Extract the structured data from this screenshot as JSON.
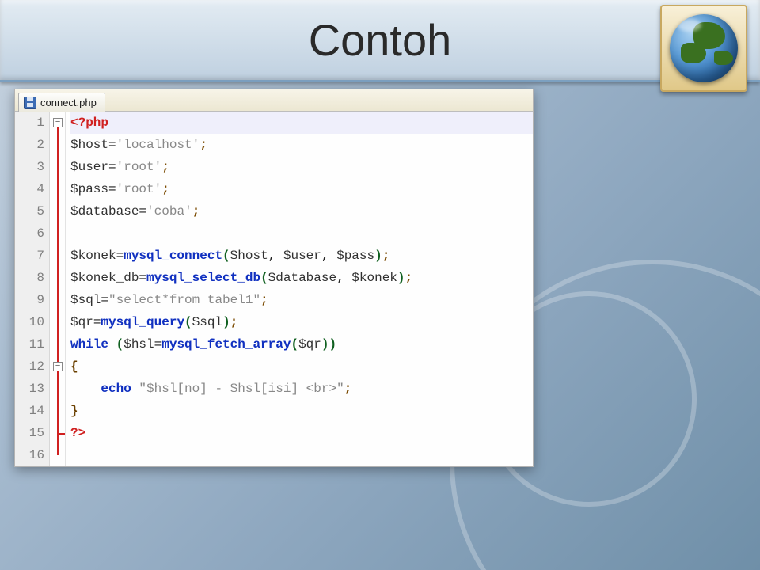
{
  "slide": {
    "title": "Contoh"
  },
  "decor": {
    "globe_icon": "globe-icon"
  },
  "editor": {
    "tab": {
      "filename": "connect.php",
      "save_icon": "save-icon"
    },
    "fold": {
      "box1_glyph": "−",
      "box2_glyph": "−"
    },
    "gutter": [
      "1",
      "2",
      "3",
      "4",
      "5",
      "6",
      "7",
      "8",
      "9",
      "10",
      "11",
      "12",
      "13",
      "14",
      "15",
      "16"
    ],
    "lines": [
      {
        "n": 1,
        "hl": true,
        "tokens": [
          {
            "cls": "c-end",
            "t": "<?php"
          }
        ]
      },
      {
        "n": 2,
        "tokens": [
          {
            "cls": "c-var",
            "t": "$host"
          },
          {
            "cls": "c-op",
            "t": "="
          },
          {
            "cls": "c-str",
            "t": "'localhost'"
          },
          {
            "cls": "c-pun",
            "t": ";"
          }
        ]
      },
      {
        "n": 3,
        "tokens": [
          {
            "cls": "c-var",
            "t": "$user"
          },
          {
            "cls": "c-op",
            "t": "="
          },
          {
            "cls": "c-str",
            "t": "'root'"
          },
          {
            "cls": "c-pun",
            "t": ";"
          }
        ]
      },
      {
        "n": 4,
        "tokens": [
          {
            "cls": "c-var",
            "t": "$pass"
          },
          {
            "cls": "c-op",
            "t": "="
          },
          {
            "cls": "c-str",
            "t": "'root'"
          },
          {
            "cls": "c-pun",
            "t": ";"
          }
        ]
      },
      {
        "n": 5,
        "tokens": [
          {
            "cls": "c-var",
            "t": "$database"
          },
          {
            "cls": "c-op",
            "t": "="
          },
          {
            "cls": "c-str",
            "t": "'coba'"
          },
          {
            "cls": "c-pun",
            "t": ";"
          }
        ]
      },
      {
        "n": 6,
        "tokens": []
      },
      {
        "n": 7,
        "tokens": [
          {
            "cls": "c-var",
            "t": "$konek"
          },
          {
            "cls": "c-op",
            "t": "="
          },
          {
            "cls": "c-fn",
            "t": "mysql_connect"
          },
          {
            "cls": "c-par",
            "t": "("
          },
          {
            "cls": "c-var",
            "t": "$host"
          },
          {
            "cls": "c-op",
            "t": ", "
          },
          {
            "cls": "c-var",
            "t": "$user"
          },
          {
            "cls": "c-op",
            "t": ", "
          },
          {
            "cls": "c-var",
            "t": "$pass"
          },
          {
            "cls": "c-par",
            "t": ")"
          },
          {
            "cls": "c-pun",
            "t": ";"
          }
        ]
      },
      {
        "n": 8,
        "tokens": [
          {
            "cls": "c-var",
            "t": "$konek_db"
          },
          {
            "cls": "c-op",
            "t": "="
          },
          {
            "cls": "c-fn",
            "t": "mysql_select_db"
          },
          {
            "cls": "c-par",
            "t": "("
          },
          {
            "cls": "c-var",
            "t": "$database"
          },
          {
            "cls": "c-op",
            "t": ", "
          },
          {
            "cls": "c-var",
            "t": "$konek"
          },
          {
            "cls": "c-par",
            "t": ")"
          },
          {
            "cls": "c-pun",
            "t": ";"
          }
        ]
      },
      {
        "n": 9,
        "tokens": [
          {
            "cls": "c-var",
            "t": "$sql"
          },
          {
            "cls": "c-op",
            "t": "="
          },
          {
            "cls": "c-str",
            "t": "\"select*from tabel1\""
          },
          {
            "cls": "c-pun",
            "t": ";"
          }
        ]
      },
      {
        "n": 10,
        "tokens": [
          {
            "cls": "c-var",
            "t": "$qr"
          },
          {
            "cls": "c-op",
            "t": "="
          },
          {
            "cls": "c-fn",
            "t": "mysql_query"
          },
          {
            "cls": "c-par",
            "t": "("
          },
          {
            "cls": "c-var",
            "t": "$sql"
          },
          {
            "cls": "c-par",
            "t": ")"
          },
          {
            "cls": "c-pun",
            "t": ";"
          }
        ]
      },
      {
        "n": 11,
        "tokens": [
          {
            "cls": "c-kw",
            "t": "while "
          },
          {
            "cls": "c-par",
            "t": "("
          },
          {
            "cls": "c-var",
            "t": "$hsl"
          },
          {
            "cls": "c-op",
            "t": "="
          },
          {
            "cls": "c-fn",
            "t": "mysql_fetch_array"
          },
          {
            "cls": "c-par",
            "t": "("
          },
          {
            "cls": "c-var",
            "t": "$qr"
          },
          {
            "cls": "c-par",
            "t": ")"
          },
          {
            "cls": "c-par",
            "t": ")"
          }
        ]
      },
      {
        "n": 12,
        "tokens": [
          {
            "cls": "c-brc",
            "t": "{"
          }
        ]
      },
      {
        "n": 13,
        "indent": "    ",
        "tokens": [
          {
            "cls": "c-kw",
            "t": "echo "
          },
          {
            "cls": "c-str",
            "t": "\"$hsl[no] - $hsl[isi] <br>\""
          },
          {
            "cls": "c-pun",
            "t": ";"
          }
        ]
      },
      {
        "n": 14,
        "tokens": [
          {
            "cls": "c-brc",
            "t": "}"
          }
        ]
      },
      {
        "n": 15,
        "tokens": [
          {
            "cls": "c-end",
            "t": "?>"
          }
        ]
      },
      {
        "n": 16,
        "tokens": []
      }
    ]
  }
}
